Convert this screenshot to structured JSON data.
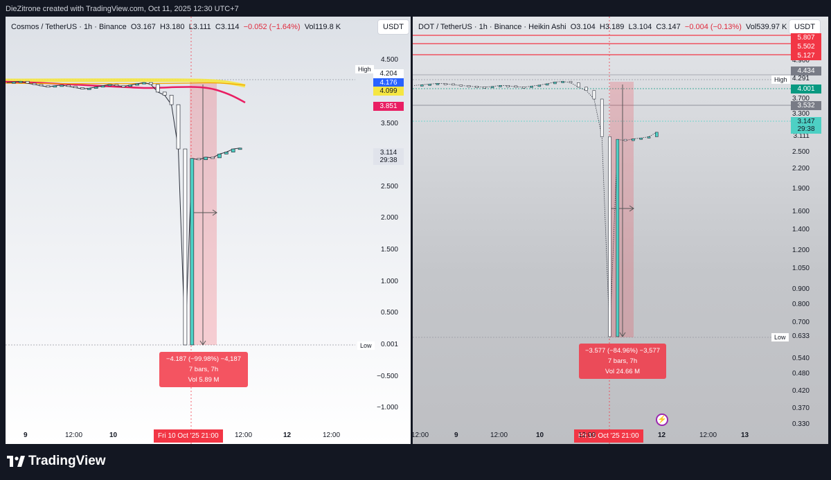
{
  "header": {
    "credit": "DieZitrone created with TradingView.com, Oct 11, 2025 12:30 UTC+7"
  },
  "footer": {
    "brand": "TradingView",
    "logo": "tradingview-logo"
  },
  "charts": [
    {
      "id": "left",
      "legend": {
        "symbol": "Cosmos / TetherUS · 1h · Binance",
        "o_label": "O",
        "o": "3.167",
        "h_label": "H",
        "h": "3.180",
        "l_label": "L",
        "l": "3.111",
        "c_label": "C",
        "c": "3.114",
        "change": "−0.052 (−1.64%)",
        "vol_label": "Vol",
        "vol": "119.8 K"
      },
      "currency": "USDT",
      "y_ticks": [
        "4.500",
        "4.000",
        "3.500",
        "3.000",
        "2.500",
        "2.000",
        "1.500",
        "1.000",
        "0.500",
        "0.001",
        "−0.500",
        "−1.000"
      ],
      "tags": [
        {
          "text": "4.204",
          "color": "#ffffff",
          "fg": "#131722"
        },
        {
          "text": "4.176",
          "color": "#2962ff",
          "fg": "#ffffff"
        },
        {
          "text": "4.099",
          "color": "#f5e642",
          "fg": "#131722"
        },
        {
          "text": "3.851",
          "color": "#e91e63",
          "fg": "#ffffff"
        },
        {
          "text": "3.114",
          "color": "#e0e3eb",
          "fg": "#131722"
        },
        {
          "text": "29:38",
          "color": "#e0e3eb",
          "fg": "#131722"
        }
      ],
      "high_label": "High",
      "low_label": "Low",
      "x_labels": [
        {
          "text": "9",
          "bold": true
        },
        {
          "text": "12:00",
          "bold": false
        },
        {
          "text": "10",
          "bold": true
        },
        {
          "text": "12:00",
          "bold": false
        },
        {
          "text": "12",
          "bold": true
        },
        {
          "text": "12:00",
          "bold": false
        }
      ],
      "x_tag": "Fri 10 Oct '25   21:00",
      "measure": {
        "line1": "−4.187 (−99.98%) −4,187",
        "line2": "7 bars, 7h",
        "line3": "Vol 5.89 M"
      }
    },
    {
      "id": "right",
      "legend": {
        "symbol": "DOT / TetherUS · 1h · Binance · Heikin Ashi",
        "o_label": "O",
        "o": "3.104",
        "h_label": "H",
        "h": "3.189",
        "l_label": "L",
        "l": "3.104",
        "c_label": "C",
        "c": "3.147",
        "change": "−0.004 (−0.13%)",
        "vol_label": "Vol",
        "vol": "539.97 K"
      },
      "currency": "USDT",
      "y_ticks": [
        "4.900",
        "4.291",
        "3.700",
        "3.300",
        "3.111",
        "2.500",
        "2.200",
        "1.900",
        "1.600",
        "1.400",
        "1.200",
        "1.050",
        "0.900",
        "0.800",
        "0.700",
        "0.633",
        "0.540",
        "0.480",
        "0.420",
        "0.370",
        "0.330"
      ],
      "tags": [
        {
          "text": "5.807",
          "color": "#f23645",
          "fg": "#ffffff"
        },
        {
          "text": "5.502",
          "color": "#f23645",
          "fg": "#ffffff"
        },
        {
          "text": "5.127",
          "color": "#f23645",
          "fg": "#ffffff"
        },
        {
          "text": "4.434",
          "color": "#787b86",
          "fg": "#ffffff"
        },
        {
          "text": "4.001",
          "color": "#089981",
          "fg": "#ffffff"
        },
        {
          "text": "3.532",
          "color": "#787b86",
          "fg": "#ffffff"
        },
        {
          "text": "3.147",
          "color": "#4dd0c4",
          "fg": "#131722"
        },
        {
          "text": "29:38",
          "color": "#4dd0c4",
          "fg": "#131722"
        }
      ],
      "high_label": "High",
      "low_label": "Low",
      "x_labels": [
        {
          "text": "12:00",
          "bold": false
        },
        {
          "text": "9",
          "bold": true
        },
        {
          "text": "12:00",
          "bold": false
        },
        {
          "text": "10",
          "bold": true
        },
        {
          "text": "12:00",
          "bold": false
        },
        {
          "text": "12",
          "bold": true
        },
        {
          "text": "12:00",
          "bold": false
        },
        {
          "text": "13",
          "bold": true
        }
      ],
      "x_tag": "Fri 10 Oct '25   21:00",
      "measure": {
        "line1": "−3.577 (−84.96%) −3,577",
        "line2": "7 bars, 7h",
        "line3": "Vol 24.66 M"
      }
    }
  ],
  "chart_data": [
    {
      "type": "line",
      "title": "Cosmos / TetherUS · 1h · Binance",
      "ylabel": "USDT",
      "ylim": [
        -1.2,
        4.7
      ],
      "grid": false,
      "series": [
        {
          "name": "",
          "values": [
            4.15,
            4.16,
            4.17,
            4.14,
            4.12,
            4.1,
            4.08,
            4.1,
            4.11,
            4.09,
            4.07,
            4.05,
            4.06,
            4.08,
            4.1,
            4.12,
            4.1,
            4.09,
            4.11,
            4.13,
            4.15,
            4.12,
            4.0,
            3.95,
            3.8,
            3.1,
            0.001,
            2.95,
            2.93,
            2.97,
            2.96,
            3.02,
            3.05,
            3.1,
            3.114
          ]
        }
      ],
      "annotations": [
        "High 4.204",
        "Low 0.001"
      ]
    },
    {
      "type": "line",
      "title": "DOT / TetherUS · 1h · Binance · Heikin Ashi",
      "ylabel": "USDT",
      "ylim": [
        0.3,
        6.0
      ],
      "grid": false,
      "series": [
        {
          "name": "",
          "values": [
            4.1,
            4.12,
            4.14,
            4.16,
            4.15,
            4.12,
            4.1,
            4.08,
            4.06,
            4.05,
            4.07,
            4.1,
            4.09,
            4.06,
            4.05,
            4.08,
            4.11,
            4.15,
            4.2,
            4.22,
            4.18,
            4.05,
            3.95,
            3.7,
            3.1,
            0.633,
            3.0,
            2.95,
            3.02,
            3.05,
            3.1,
            3.147
          ]
        }
      ],
      "annotations": [
        "High 4.291",
        "Low 0.633"
      ]
    }
  ]
}
